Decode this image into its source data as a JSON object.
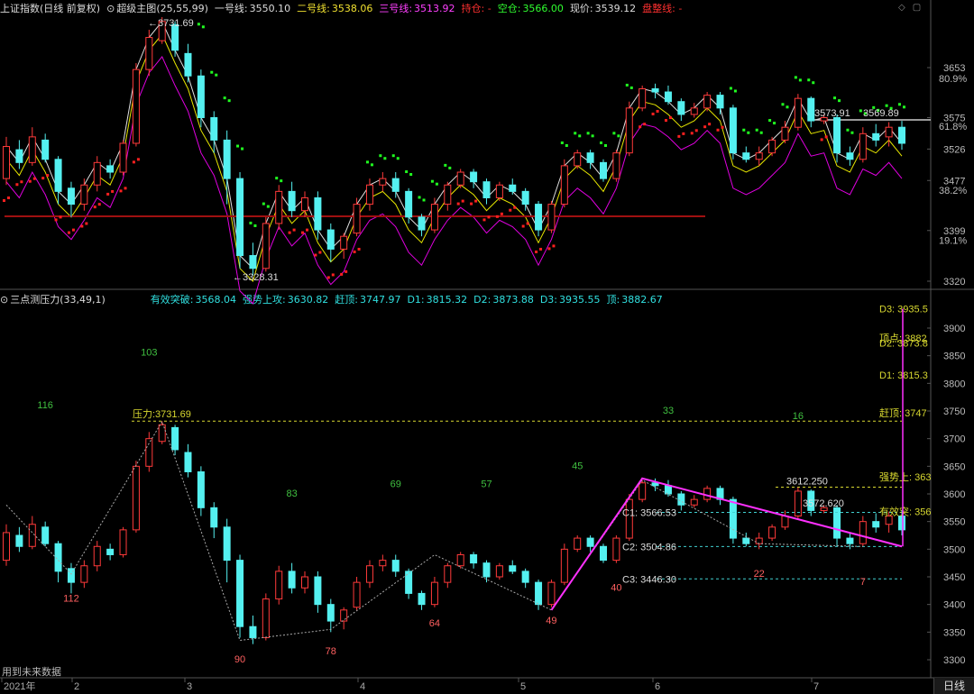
{
  "colors": {
    "up": "#ff3a3a",
    "down": "#54f0f0",
    "bg": "#000000",
    "axis": "#555555",
    "ma1": "#e0e0e0",
    "ma2": "#e6e600",
    "ma3": "#e000e0",
    "dot_red": "#ff2020",
    "dot_green": "#20ff20",
    "guide": "#d8d830",
    "cline": "#40d0d0",
    "trend": "#ff30ff"
  },
  "header": {
    "index_name": "上证指数",
    "period_label": "(日线 前复权)",
    "indicator_name": "超级主图",
    "params": "(25,55,99)",
    "line1_label": "一号线:",
    "line1_value": "3550.10",
    "line2_label": "二号线:",
    "line2_value": "3538.06",
    "line3_label": "三号线:",
    "line3_value": "3513.92",
    "hold_label": "持仓: -",
    "empty_label": "空仓:",
    "empty_value": "3566.00",
    "price_label": "现价:",
    "price_value": "3539.12",
    "consol_label": "盘整线: -"
  },
  "top_axis": {
    "ticks": [
      {
        "label": "3653",
        "v": 3653
      },
      {
        "label": "3575",
        "v": 3575
      },
      {
        "label": "3526",
        "v": 3526
      },
      {
        "label": "3477",
        "v": 3477
      },
      {
        "label": "3399",
        "v": 3399
      },
      {
        "label": "3320",
        "v": 3320
      }
    ],
    "fib": [
      {
        "label": "80.9%",
        "v": 3636
      },
      {
        "label": "61.8%",
        "v": 3562
      },
      {
        "label": "38.2%",
        "v": 3462
      },
      {
        "label": "19.1%",
        "v": 3384
      }
    ]
  },
  "top_labels": {
    "high": "3731.69",
    "low": "3328.31",
    "hl1": "3573.91",
    "hl2": "3569.89"
  },
  "sub": {
    "name": "三点测压力",
    "params": "(33,49,1)",
    "effective_label": "有效突破:",
    "effective_value": "3568.04",
    "strong_label": "强势上攻:",
    "strong_value": "3630.82",
    "top_label": "赶顶:",
    "top_value": "3747.97",
    "d1_label": "D1:",
    "d1_value": "3815.32",
    "d2_label": "D2:",
    "d2_value": "3873.88",
    "d3_label": "D3:",
    "d3_value": "3935.55",
    "peak_label": "顶:",
    "peak_value": "3882.67"
  },
  "sub_axis": {
    "ticks": [
      {
        "label": "3900",
        "v": 3900
      },
      {
        "label": "3850",
        "v": 3850
      },
      {
        "label": "3800",
        "v": 3800
      },
      {
        "label": "3750",
        "v": 3750
      },
      {
        "label": "3700",
        "v": 3700
      },
      {
        "label": "3650",
        "v": 3650
      },
      {
        "label": "3600",
        "v": 3600
      },
      {
        "label": "3550",
        "v": 3550
      },
      {
        "label": "3500",
        "v": 3500
      },
      {
        "label": "3450",
        "v": 3450
      },
      {
        "label": "3400",
        "v": 3400
      },
      {
        "label": "3350",
        "v": 3350
      },
      {
        "label": "3300",
        "v": 3300
      }
    ]
  },
  "sub_labels": {
    "pressure": "压力:3731.69",
    "c1": "C1: 3566.53",
    "c2": "C2: 3504.86",
    "c3": "C3: 3446.30",
    "p1": "3612.250",
    "p2": "3572.620",
    "r_d3": "D3: 3935.5",
    "r_peak": "顶点: 3882",
    "r_d2": "D2: 3873.8",
    "r_d1": "D1: 3815.3",
    "r_top": "赶顶: 3747",
    "r_strong": "强势上: 363",
    "r_eff": "有效突: 356"
  },
  "counts": [
    {
      "t": "116",
      "c": "g",
      "v": 3755,
      "i": 3
    },
    {
      "t": "103",
      "c": "g",
      "v": 3850,
      "i": 11
    },
    {
      "t": "83",
      "c": "g",
      "v": 3595,
      "i": 22
    },
    {
      "t": "69",
      "c": "g",
      "v": 3612,
      "i": 30
    },
    {
      "t": "57",
      "c": "g",
      "v": 3612,
      "i": 37
    },
    {
      "t": "45",
      "c": "g",
      "v": 3645,
      "i": 44
    },
    {
      "t": "33",
      "c": "g",
      "v": 3745,
      "i": 51
    },
    {
      "t": "16",
      "c": "g",
      "v": 3735,
      "i": 61
    },
    {
      "t": "112",
      "c": "r",
      "v": 3405,
      "i": 5
    },
    {
      "t": "90",
      "c": "r",
      "v": 3295,
      "i": 18
    },
    {
      "t": "78",
      "c": "r",
      "v": 3310,
      "i": 25
    },
    {
      "t": "64",
      "c": "r",
      "v": 3360,
      "i": 33
    },
    {
      "t": "49",
      "c": "r",
      "v": 3365,
      "i": 42
    },
    {
      "t": "40",
      "c": "r",
      "v": 3425,
      "i": 47
    },
    {
      "t": "22",
      "c": "r",
      "v": 3450,
      "i": 58
    },
    {
      "t": "7",
      "c": "r",
      "v": 3435,
      "i": 66
    }
  ],
  "footer": {
    "note": "用到未来数据",
    "year": "2021年",
    "m2": "2",
    "m3": "3",
    "m4": "4",
    "m5": "5",
    "m6": "6",
    "m7": "7",
    "tab": "日线"
  },
  "candles": [
    [
      3480,
      3530,
      3470,
      3545
    ],
    [
      3525,
      3505,
      3495,
      3540
    ],
    [
      3505,
      3545,
      3500,
      3560
    ],
    [
      3540,
      3510,
      3505,
      3550
    ],
    [
      3510,
      3460,
      3440,
      3515
    ],
    [
      3465,
      3440,
      3420,
      3475
    ],
    [
      3440,
      3470,
      3430,
      3480
    ],
    [
      3470,
      3505,
      3460,
      3515
    ],
    [
      3500,
      3490,
      3480,
      3510
    ],
    [
      3490,
      3535,
      3485,
      3540
    ],
    [
      3535,
      3650,
      3530,
      3660
    ],
    [
      3650,
      3700,
      3640,
      3712
    ],
    [
      3695,
      3725,
      3690,
      3731.69
    ],
    [
      3720,
      3680,
      3670,
      3725
    ],
    [
      3675,
      3640,
      3630,
      3690
    ],
    [
      3640,
      3575,
      3560,
      3650
    ],
    [
      3575,
      3540,
      3520,
      3585
    ],
    [
      3540,
      3480,
      3440,
      3555
    ],
    [
      3480,
      3360,
      3340,
      3490
    ],
    [
      3360,
      3340,
      3328.31,
      3380
    ],
    [
      3340,
      3410,
      3335,
      3420
    ],
    [
      3410,
      3460,
      3400,
      3470
    ],
    [
      3460,
      3430,
      3420,
      3475
    ],
    [
      3430,
      3450,
      3420,
      3460
    ],
    [
      3450,
      3400,
      3385,
      3460
    ],
    [
      3400,
      3370,
      3350,
      3410
    ],
    [
      3370,
      3390,
      3355,
      3395
    ],
    [
      3395,
      3440,
      3390,
      3450
    ],
    [
      3440,
      3470,
      3430,
      3480
    ],
    [
      3470,
      3480,
      3460,
      3490
    ],
    [
      3480,
      3460,
      3450,
      3490
    ],
    [
      3460,
      3420,
      3410,
      3465
    ],
    [
      3420,
      3400,
      3390,
      3425
    ],
    [
      3400,
      3440,
      3395,
      3450
    ],
    [
      3440,
      3470,
      3430,
      3475
    ],
    [
      3470,
      3490,
      3465,
      3495
    ],
    [
      3490,
      3475,
      3465,
      3495
    ],
    [
      3475,
      3450,
      3440,
      3480
    ],
    [
      3450,
      3470,
      3445,
      3475
    ],
    [
      3470,
      3460,
      3455,
      3480
    ],
    [
      3460,
      3440,
      3430,
      3465
    ],
    [
      3440,
      3400,
      3390,
      3445
    ],
    [
      3400,
      3440,
      3395,
      3445
    ],
    [
      3440,
      3500,
      3435,
      3510
    ],
    [
      3500,
      3520,
      3495,
      3525
    ],
    [
      3520,
      3505,
      3495,
      3525
    ],
    [
      3505,
      3480,
      3475,
      3510
    ],
    [
      3480,
      3520,
      3475,
      3525
    ],
    [
      3520,
      3590,
      3515,
      3600
    ],
    [
      3590,
      3620,
      3585,
      3625
    ],
    [
      3620,
      3615,
      3605,
      3628
    ],
    [
      3615,
      3600,
      3595,
      3625
    ],
    [
      3600,
      3580,
      3570,
      3605
    ],
    [
      3580,
      3590,
      3575,
      3598
    ],
    [
      3590,
      3610,
      3585,
      3615
    ],
    [
      3610,
      3590,
      3580,
      3615
    ],
    [
      3590,
      3520,
      3510,
      3595
    ],
    [
      3520,
      3510,
      3505,
      3530
    ],
    [
      3510,
      3520,
      3500,
      3530
    ],
    [
      3520,
      3540,
      3515,
      3545
    ],
    [
      3540,
      3560,
      3535,
      3570
    ],
    [
      3560,
      3605,
      3555,
      3612
    ],
    [
      3605,
      3570,
      3560,
      3608
    ],
    [
      3570,
      3575,
      3565,
      3580
    ],
    [
      3575,
      3520,
      3505,
      3580
    ],
    [
      3520,
      3510,
      3500,
      3530
    ],
    [
      3510,
      3550,
      3505,
      3560
    ],
    [
      3550,
      3540,
      3530,
      3565
    ],
    [
      3545,
      3560,
      3530,
      3568
    ],
    [
      3560,
      3535,
      3525,
      3570
    ]
  ]
}
